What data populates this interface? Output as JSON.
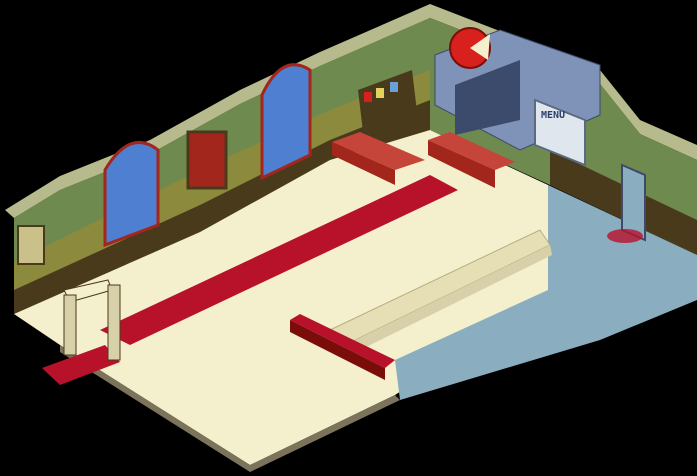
{
  "room": {
    "menu_board_label": "MENU"
  },
  "colors": {
    "background": "#000000",
    "wall_olive": "#8c8a3c",
    "wall_green": "#6e8a4e",
    "wall_top": "#b6ba8c",
    "wainscot": "#4a3a1c",
    "floor_cream": "#f4efcc",
    "floor_blue": "#8aaec0",
    "carpet_red": "#b8122a",
    "counter_red": "#a3261c",
    "kitchen_steel": "#7f93b8",
    "window_sky": "#4f7fd0",
    "pizza_sign_red": "#d8201c"
  },
  "icons": {
    "sign": "pizza-slice-sign-icon",
    "menu": "menu-board-icon",
    "door": "elevator-door-icon"
  }
}
